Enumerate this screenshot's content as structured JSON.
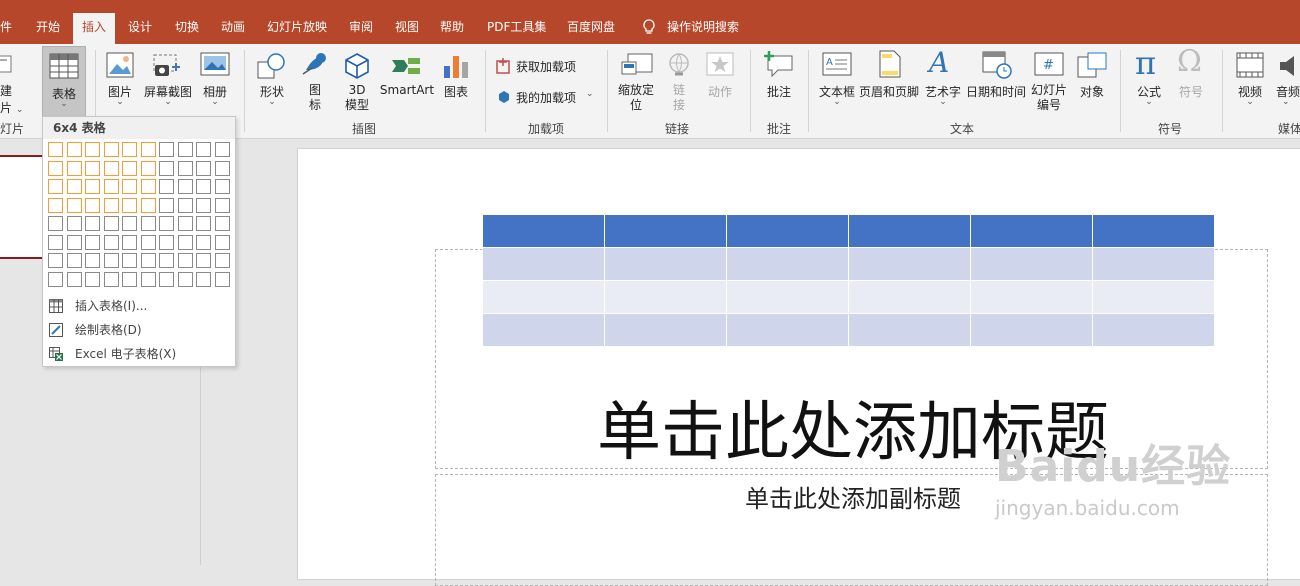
{
  "tabs": [
    {
      "label": "件"
    },
    {
      "label": "开始"
    },
    {
      "label": "插入",
      "active": true
    },
    {
      "label": "设计"
    },
    {
      "label": "切换"
    },
    {
      "label": "动画"
    },
    {
      "label": "幻灯片放映"
    },
    {
      "label": "审阅"
    },
    {
      "label": "视图"
    },
    {
      "label": "帮助"
    },
    {
      "label": "PDF工具集"
    },
    {
      "label": "百度网盘"
    },
    {
      "label": "操作说明搜索"
    }
  ],
  "ribbon": {
    "new_slide": {
      "line1": "建",
      "line2": "片",
      "group": "灯片"
    },
    "table": {
      "label": "表格"
    },
    "images": {
      "picture": "图片",
      "screenshot": "屏幕截图",
      "album": "相册"
    },
    "illustrations": {
      "shapes": "形状",
      "icons": "图\n标",
      "model3d": "3D\n模型",
      "smartart": "SmartArt",
      "chart": "图表",
      "group": "插图"
    },
    "addins": {
      "get": "获取加载项",
      "mine": "我的加载项",
      "group": "加载项"
    },
    "links": {
      "zoom": "缩放定\n位",
      "link": "链\n接",
      "action": "动作",
      "group": "链接"
    },
    "comments": {
      "comment": "批注",
      "group": "批注"
    },
    "text": {
      "textbox": "文本框",
      "header_footer": "页眉和页脚",
      "wordart": "艺术字",
      "datetime": "日期和时间",
      "slide_number": "幻灯片\n编号",
      "object": "对象",
      "group": "文本"
    },
    "symbols": {
      "equation": "公式",
      "symbol": "符号",
      "group": "符号"
    },
    "media": {
      "video": "视频",
      "audio": "音频",
      "group": "媒体"
    }
  },
  "table_menu": {
    "header": "6x4 表格",
    "grid_cols": 10,
    "grid_rows": 8,
    "selected_cols": 6,
    "selected_rows": 4,
    "items": [
      {
        "label": "插入表格(I)..."
      },
      {
        "label": "绘制表格(D)"
      },
      {
        "label": "Excel 电子表格(X)"
      }
    ]
  },
  "slide": {
    "title_placeholder": "单击此处添加标题",
    "subtitle_placeholder": "单击此处添加副标题",
    "table_preview": {
      "cols": 6,
      "rows": 4
    }
  },
  "watermark": {
    "logo": "Baidu经验",
    "url": "jingyan.baidu.com"
  },
  "colors": {
    "accent": "#b7472a",
    "table_header": "#4472c4",
    "table_band1": "#cfd5ea",
    "table_band2": "#e9ebf5",
    "grid_highlight": "#f39c38"
  }
}
